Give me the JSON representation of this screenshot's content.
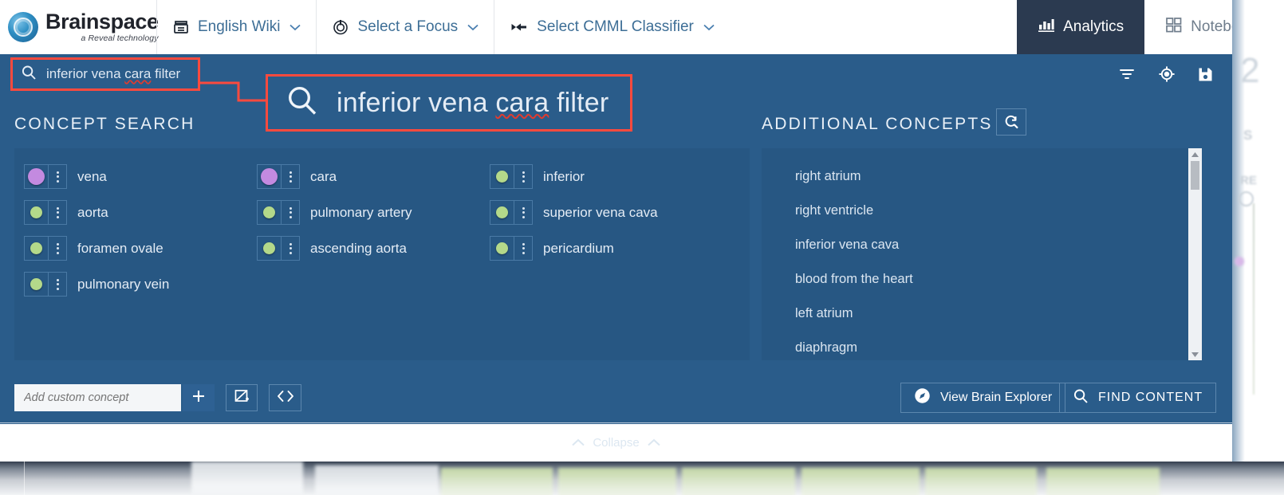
{
  "brand": {
    "name": "Brainspace",
    "tagline": "a Reveal technology",
    "logo_icon": "brainspace-logo-icon"
  },
  "topnav": {
    "items": [
      {
        "label": "English Wiki",
        "icon": "dataset-icon",
        "caret": "⌄"
      },
      {
        "label": "Select a Focus",
        "icon": "focus-target-icon",
        "caret": "⌄"
      },
      {
        "label": "Select CMML Classifier",
        "icon": "classifier-icon",
        "caret": "⌄"
      }
    ],
    "tabs": [
      {
        "label": "Analytics",
        "icon": "bar-chart-icon",
        "active": true
      },
      {
        "label": "Notebooks",
        "icon": "grid-squares-icon",
        "active": false
      }
    ]
  },
  "search": {
    "icon": "search-icon",
    "value_before": "inferior vena ",
    "value_misspelled": "cara",
    "value_after": " filter",
    "full_value": "inferior vena cara filter",
    "strip_icons": [
      {
        "name": "filter-icon"
      },
      {
        "name": "focus-target-icon"
      },
      {
        "name": "save-icon"
      }
    ]
  },
  "callout": {
    "icon": "search-icon",
    "text_before": "inferior vena ",
    "text_misspelled": "cara",
    "text_after": " filter",
    "highlight_color": "#fb4a3e"
  },
  "concept_search": {
    "title": "CONCEPT SEARCH",
    "concepts": [
      {
        "label": "vena",
        "dot_color": "#c38ae0",
        "large": true
      },
      {
        "label": "cara",
        "dot_color": "#c38ae0",
        "large": true
      },
      {
        "label": "inferior",
        "dot_color": "#b4d98a",
        "large": false
      },
      {
        "label": "aorta",
        "dot_color": "#b4d98a",
        "large": false
      },
      {
        "label": "pulmonary artery",
        "dot_color": "#b4d98a",
        "large": false
      },
      {
        "label": "superior vena cava",
        "dot_color": "#b4d98a",
        "large": false
      },
      {
        "label": "foramen ovale",
        "dot_color": "#b4d98a",
        "large": false
      },
      {
        "label": "ascending aorta",
        "dot_color": "#b4d98a",
        "large": false
      },
      {
        "label": "pericardium",
        "dot_color": "#b4d98a",
        "large": false
      },
      {
        "label": "pulmonary vein",
        "dot_color": "#b4d98a",
        "large": false
      }
    ]
  },
  "additional_concepts": {
    "title": "ADDITIONAL CONCEPTS",
    "refresh_icon": "refresh-search-icon",
    "items": [
      "right atrium",
      "right ventricle",
      "inferior vena cava",
      "blood from the heart",
      "left atrium",
      "diaphragm"
    ]
  },
  "toolbar": {
    "add_concept_placeholder": "Add custom concept",
    "add_concept_value": "",
    "add_button_icon": "plus-icon",
    "image_button_icon": "image-add-icon",
    "code_button_icon": "code-brackets-icon",
    "brain_explorer_label": "View Brain Explorer",
    "brain_explorer_icon": "compass-icon",
    "find_content_label": "FIND CONTENT",
    "find_content_icon": "search-icon"
  },
  "collapse": {
    "label": "Collapse",
    "chevron_left": "⌃",
    "chevron_right": "⌃"
  },
  "right_panel_preview": {
    "number": "2",
    "letter_s": "S",
    "letters_re": "RE"
  },
  "colors": {
    "panel_blue": "#2a5c8a",
    "inner_blue": "#275783",
    "nav_active": "#2b3a50",
    "highlight_red": "#fb4a3e",
    "concept_purple": "#c38ae0",
    "concept_green": "#b4d98a"
  }
}
